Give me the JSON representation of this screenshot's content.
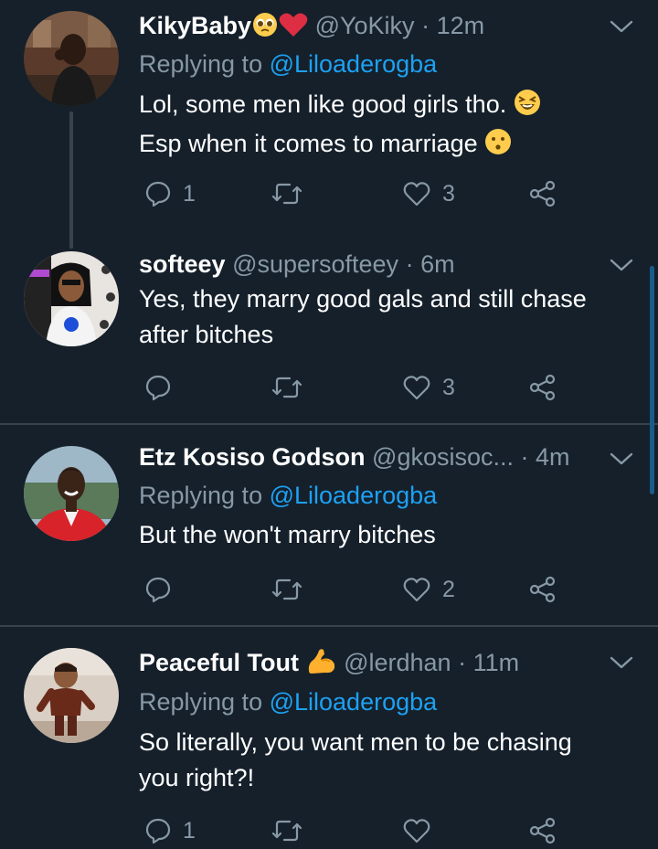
{
  "colors": {
    "background": "#15202b",
    "text": "#ffffff",
    "muted": "#8899a6",
    "link": "#1da1f2",
    "divider": "#38444d"
  },
  "tweets": [
    {
      "name": "KikyBaby",
      "name_emojis": [
        "pleading-face-emoji",
        "red-heart-emoji"
      ],
      "handle": "@YoKiky",
      "dot": "·",
      "time": "12m",
      "replying_prefix": "Replying to ",
      "replying_to": "@Liloaderogba",
      "lines": [
        "Lol, some men like good girls tho.",
        "Esp when it comes to marriage"
      ],
      "line_emojis": [
        "laughing-face-emoji",
        "kissing-face-emoji"
      ],
      "reply_count": "1",
      "retweet_count": "",
      "like_count": "3"
    },
    {
      "name": "softeey",
      "handle": "@supersofteey",
      "dot": "·",
      "time": "6m",
      "lines": [
        "Yes, they marry good gals and still chase",
        "after bitches"
      ],
      "reply_count": "",
      "retweet_count": "",
      "like_count": "3"
    },
    {
      "name": "Etz Kosiso Godson",
      "handle": "@gkosisoc...",
      "dot": "·",
      "time": "4m",
      "replying_prefix": "Replying to ",
      "replying_to": "@Liloaderogba",
      "lines": [
        "But the won't marry bitches"
      ],
      "reply_count": "",
      "retweet_count": "",
      "like_count": "2"
    },
    {
      "name": "Peaceful Tout",
      "name_emojis": [
        "flexed-biceps-emoji"
      ],
      "handle": "@lerdhan",
      "dot": "·",
      "time": "11m",
      "replying_prefix": "Replying to ",
      "replying_to": "@Liloaderogba",
      "lines": [
        "So literally, you want men to be chasing",
        "you right?!"
      ],
      "reply_count": "1",
      "retweet_count": "",
      "like_count": ""
    }
  ]
}
